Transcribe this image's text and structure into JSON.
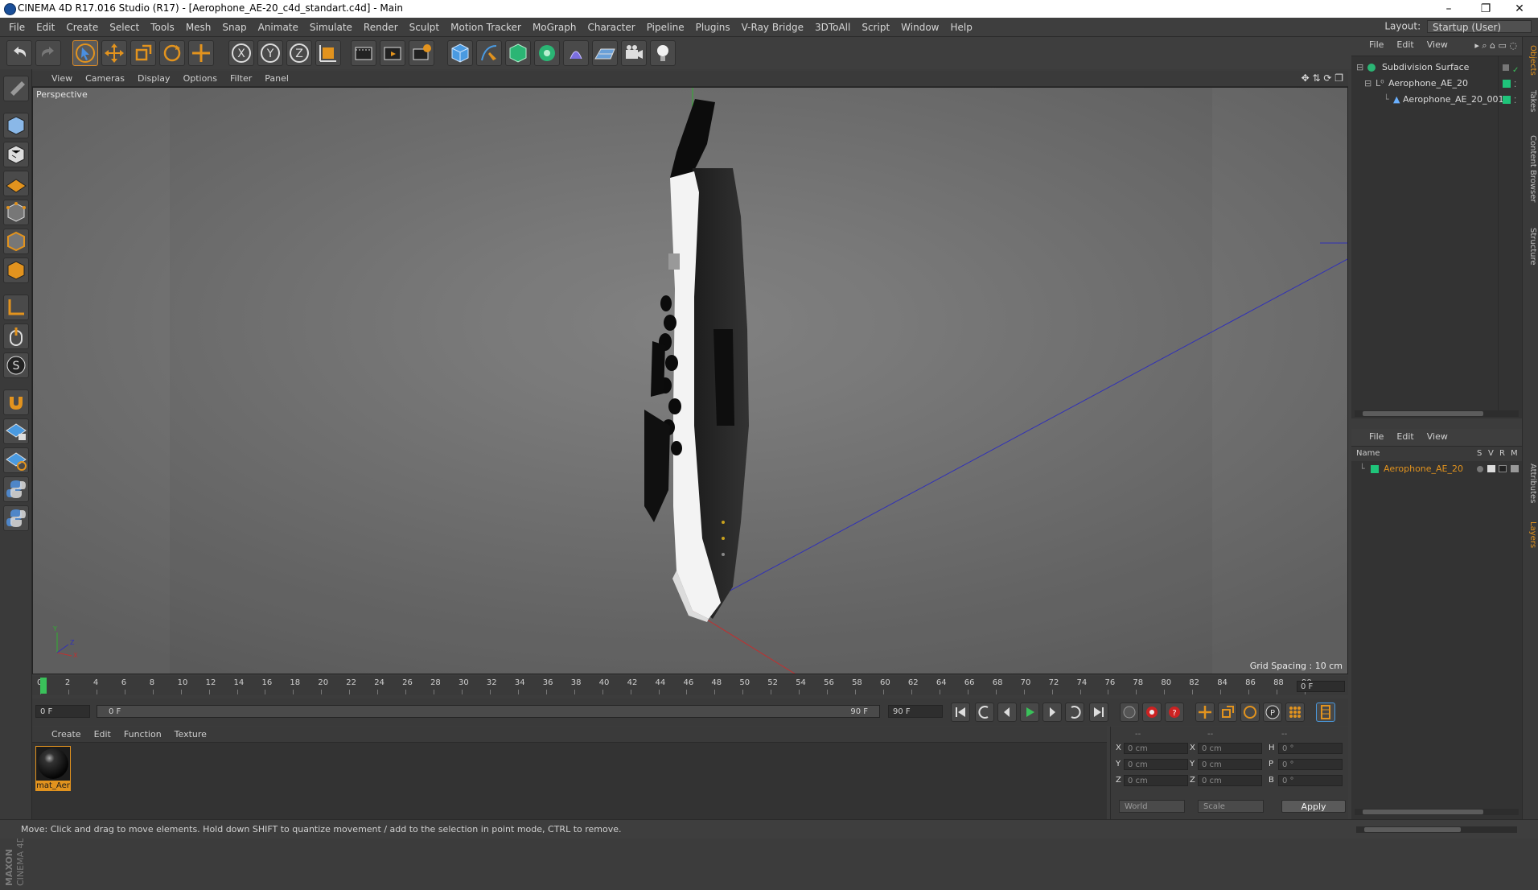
{
  "window": {
    "title": "CINEMA 4D R17.016 Studio (R17) - [Aerophone_AE-20_c4d_standart.c4d] - Main",
    "minimize": "–",
    "maximize": "❐",
    "close": "✕"
  },
  "menu": {
    "items": [
      "File",
      "Edit",
      "Create",
      "Select",
      "Tools",
      "Mesh",
      "Snap",
      "Animate",
      "Simulate",
      "Render",
      "Sculpt",
      "Motion Tracker",
      "MoGraph",
      "Character",
      "Pipeline",
      "Plugins",
      "V-Ray Bridge",
      "3DToAll",
      "Script",
      "Window",
      "Help"
    ],
    "layout_label": "Layout:",
    "layout_value": "Startup (User)"
  },
  "viewport": {
    "menu": [
      "View",
      "Cameras",
      "Display",
      "Options",
      "Filter",
      "Panel"
    ],
    "label": "Perspective",
    "grid_spacing": "Grid Spacing : 10 cm"
  },
  "timeline": {
    "ticks": [
      "0",
      "2",
      "4",
      "6",
      "8",
      "10",
      "12",
      "14",
      "16",
      "18",
      "20",
      "22",
      "24",
      "26",
      "28",
      "30",
      "32",
      "34",
      "36",
      "38",
      "40",
      "42",
      "44",
      "46",
      "48",
      "50",
      "52",
      "54",
      "56",
      "58",
      "60",
      "62",
      "64",
      "66",
      "68",
      "70",
      "72",
      "74",
      "76",
      "78",
      "80",
      "82",
      "84",
      "86",
      "88",
      "90"
    ],
    "current_frame": "0 F",
    "start_field": "0 F",
    "range_start": "0 F",
    "range_end": "90 F",
    "end_field": "90 F"
  },
  "materials": {
    "menu": [
      "Create",
      "Edit",
      "Function",
      "Texture"
    ],
    "items": [
      {
        "label": "mat_Aer"
      }
    ]
  },
  "coords": {
    "header": [
      "--",
      "--",
      "--"
    ],
    "rows": [
      {
        "l1": "X",
        "v1": "0 cm",
        "l2": "X",
        "v2": "0 cm",
        "l3": "H",
        "v3": "0 °"
      },
      {
        "l1": "Y",
        "v1": "0 cm",
        "l2": "Y",
        "v2": "0 cm",
        "l3": "P",
        "v3": "0 °"
      },
      {
        "l1": "Z",
        "v1": "0 cm",
        "l2": "Z",
        "v2": "0 cm",
        "l3": "B",
        "v3": "0 °"
      }
    ],
    "world": "World",
    "scale": "Scale",
    "apply": "Apply"
  },
  "objects": {
    "menu": [
      "File",
      "Edit",
      "View"
    ],
    "items": [
      {
        "label": "Subdivision Surface"
      },
      {
        "label": "Aerophone_AE_20"
      },
      {
        "label": "Aerophone_AE_20_001"
      }
    ]
  },
  "layers": {
    "menu": [
      "File",
      "Edit",
      "View"
    ],
    "header": {
      "name": "Name",
      "s": "S",
      "v": "V",
      "r": "R",
      "m": "M"
    },
    "items": [
      {
        "label": "Aerophone_AE_20"
      }
    ]
  },
  "sidebar_tabs": [
    "Objects",
    "Takes",
    "Content Browser",
    "Structure",
    "Attributes",
    "Layers"
  ],
  "status": "Move: Click and drag to move elements. Hold down SHIFT to quantize movement / add to the selection in point mode, CTRL to remove.",
  "colors": {
    "accent": "#e2931e",
    "layer_green": "#1fc47a",
    "axis_blue": "#3030b8",
    "axis_red": "#c03030",
    "axis_green": "#30b030"
  }
}
